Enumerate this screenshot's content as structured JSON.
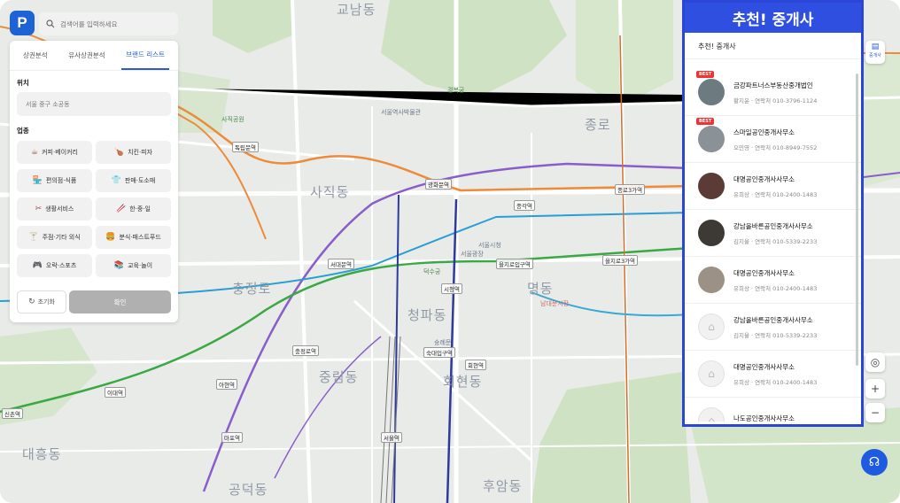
{
  "app": {
    "logo_letter": "P",
    "brand_color": "#1e63d6"
  },
  "search": {
    "placeholder": "검색어를 입력하세요"
  },
  "tabs": [
    {
      "label": "상권분석"
    },
    {
      "label": "유사상권분석"
    },
    {
      "label": "브랜드 리스트"
    }
  ],
  "location": {
    "label": "위치",
    "value": "서울 중구 소공동"
  },
  "category": {
    "label": "업종",
    "items": [
      {
        "label": "커피·베이커리",
        "icon": "coffee-icon"
      },
      {
        "label": "치킨·피자",
        "icon": "chicken-icon"
      },
      {
        "label": "편의점·식품",
        "icon": "store-icon"
      },
      {
        "label": "판매·도소매",
        "icon": "shirt-icon"
      },
      {
        "label": "생활서비스",
        "icon": "scissors-icon"
      },
      {
        "label": "한·중·일",
        "icon": "chopsticks-icon"
      },
      {
        "label": "주점·기타 외식",
        "icon": "cocktail-icon"
      },
      {
        "label": "분식·패스트푸드",
        "icon": "burger-icon"
      },
      {
        "label": "오락·스포츠",
        "icon": "game-icon"
      },
      {
        "label": "교육·놀이",
        "icon": "book-icon"
      }
    ]
  },
  "buttons": {
    "reset": "초기화",
    "confirm": "확인"
  },
  "recommend": {
    "title": "추천! 중개사",
    "subtitle": "추천! 중개사",
    "agents": [
      {
        "name": "금강파트너스부동산중개법인",
        "info": "황지윤 · 연락처 010-3796-1124",
        "badge": "BEST",
        "photo": "photo"
      },
      {
        "name": "스마일공인중개사무소",
        "info": "오민영 · 연락처 010-8949-7552",
        "badge": "BEST",
        "photo": "photo"
      },
      {
        "name": "대명공인중개사사무소",
        "info": "유희상 · 연락처 010-2400-1483",
        "badge": "",
        "photo": "photo"
      },
      {
        "name": "강남올바른공인중개사사무소",
        "info": "김지율 · 연락처 010-5339-2233",
        "badge": "",
        "photo": "photo"
      },
      {
        "name": "대명공인중개사사무소",
        "info": "유희상 · 연락처 010-2400-1483",
        "badge": "",
        "photo": "photo"
      },
      {
        "name": "강남올바른공인중개사사무소",
        "info": "김지율 · 연락처 010-5339-2233",
        "badge": "",
        "photo": "none"
      },
      {
        "name": "대명공인중개사사무소",
        "info": "유희상 · 연락처 010-2400-1483",
        "badge": "",
        "photo": "none"
      },
      {
        "name": "나도공인중개사사무소",
        "info": "",
        "badge": "",
        "photo": "none"
      }
    ]
  },
  "tools": {
    "stack_label": "중개사",
    "zoom_in": "+",
    "zoom_out": "−"
  },
  "map": {
    "districts": [
      "교남동",
      "사직동",
      "종로",
      "충정로",
      "회현동",
      "후암동",
      "명동",
      "중림동",
      "청파동",
      "공덕동",
      "대흥동"
    ],
    "stations": [
      "광화문역",
      "시청역",
      "종각역",
      "을지로입구역",
      "서울역",
      "회현역",
      "숙대입구역",
      "충정로역",
      "아현역",
      "종로3가역",
      "을지로3가역",
      "이대역",
      "신촌역",
      "독립문역",
      "서대문역",
      "마포역"
    ],
    "places": [
      "경복궁",
      "서울역사박물관",
      "덕수궁",
      "서울광장",
      "남대문시장",
      "숭례문",
      "서울시청",
      "사직공원"
    ]
  }
}
